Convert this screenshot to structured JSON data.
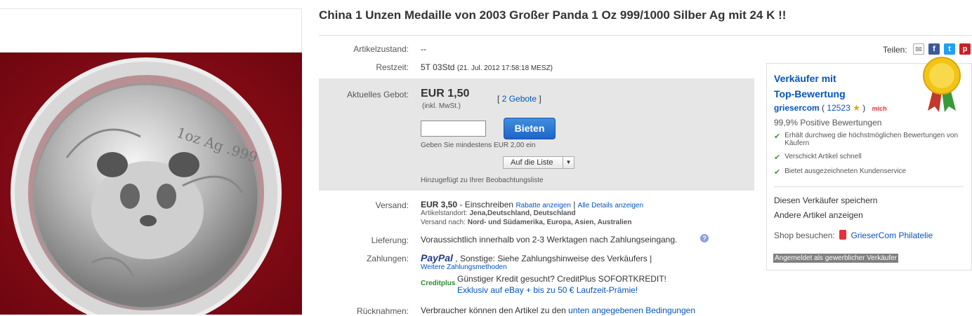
{
  "title": "China 1 Unzen Medaille von 2003 Großer Panda 1 Oz 999/1000 Silber Ag mit 24 K !!",
  "coin": {
    "inscription": "1oz Ag .999"
  },
  "share": {
    "label": "Teilen:"
  },
  "condition": {
    "label": "Artikelzustand:",
    "value": "--"
  },
  "remaining": {
    "label": "Restzeit:",
    "value": "5T 03Std",
    "end": "(21. Jul. 2012 17:58:18 MESZ)"
  },
  "bid": {
    "label": "Aktuelles Gebot:",
    "price": "EUR 1,50",
    "vat": "(inkl. MwSt.)",
    "bids_link": "2 Gebote",
    "bracket_open": "[",
    "bracket_close": "]",
    "button": "Bieten",
    "min_hint": "Geben Sie mindestens EUR 2,00 ein",
    "watch_button": "Auf die Liste",
    "watch_added": "Hinzugefügt zu Ihrer Beobachtungsliste"
  },
  "shipping": {
    "label": "Versand:",
    "price": "EUR 3,50",
    "method": "- Einschreiben",
    "discounts_link": "Rabatte anzeigen",
    "sep": "|",
    "details_link": "Alle Details anzeigen",
    "location_label": "Artikelstandort:",
    "location": "Jena,Deutschland, Deutschland",
    "to_label": "Versand nach:",
    "to": "Nord- und Südamerika, Europa, Asien, Australien"
  },
  "delivery": {
    "label": "Lieferung:",
    "value": "Voraussichtlich innerhalb von 2-3 Werktagen nach Zahlungseingang."
  },
  "payment": {
    "label": "Zahlungen:",
    "paypal": "PayPal",
    "other": ", Sonstige: Siehe Zahlungshinweise des Verkäufers |",
    "more_link": "Weitere Zahlungsmethoden",
    "creditplus_logo": "Creditplus",
    "credit_line1": "Günstiger Kredit gesucht? CreditPlus SOFORTKREDIT!",
    "credit_line2": "Exklusiv auf eBay + bis zu 50 € Laufzeit-Prämie!"
  },
  "returns": {
    "label": "Rücknahmen:",
    "value": "Verbraucher können den Artikel zu den",
    "link": "unten angegebenen Bedingungen"
  },
  "seller": {
    "heading1": "Verkäufer mit",
    "heading2": "Top-Bewertung",
    "name": "griesercom",
    "score_open": "( ",
    "score": "12523",
    "score_close": ")",
    "me_badge": "mich",
    "positive": "99,9% Positive Bewertungen",
    "perks": [
      "Erhält durchweg die höchstmöglichen Bewertungen von Käufern",
      "Verschickt Artikel schnell",
      "Bietet ausgezeichneten Kundenservice"
    ],
    "save_link": "Diesen Verkäufer speichern",
    "other_link": "Andere Artikel anzeigen",
    "shop_label": "Shop besuchen:",
    "shop_link": "GrieserCom Philatelie",
    "business": "Angemeldet als gewerblicher Verkäufer"
  },
  "colors": {
    "link": "#0654ba",
    "button": "#1e64c8",
    "bid_bg": "#e6e6e6",
    "coin_bg": "#8a0a12"
  }
}
